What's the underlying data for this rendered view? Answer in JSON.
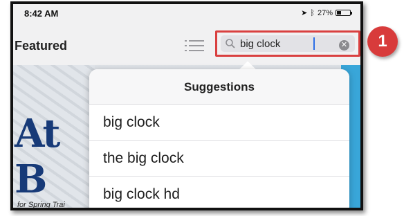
{
  "status_bar": {
    "time": "8:42 AM",
    "battery_percent": "27%",
    "icons": [
      "location-arrow-icon",
      "bluetooth-icon",
      "battery-icon"
    ]
  },
  "nav": {
    "title": "Featured",
    "list_icon": "list-icon"
  },
  "search": {
    "value": "big clock",
    "icon": "magnifier-icon",
    "clear_icon": "clear-icon",
    "highlight_color": "#d94040"
  },
  "background": {
    "banner_text": "At B",
    "caption": "for Spring Trai"
  },
  "suggestions": {
    "header": "Suggestions",
    "items": [
      "big clock",
      "the big clock",
      "big clock hd"
    ]
  },
  "callout": {
    "number": "1",
    "color": "#d83b3b"
  }
}
